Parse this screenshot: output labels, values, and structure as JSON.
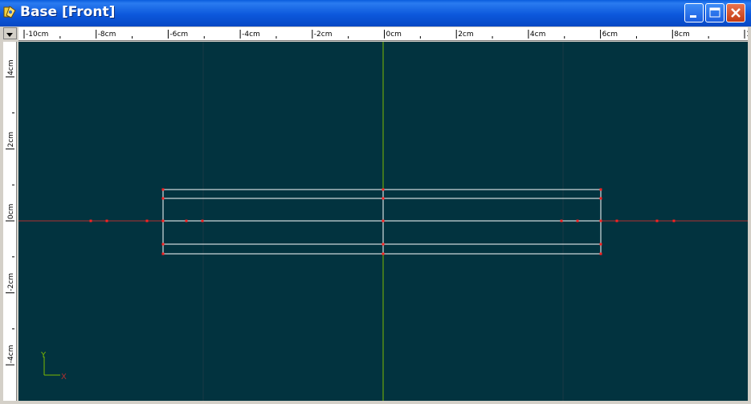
{
  "window": {
    "title": "Base [Front]",
    "buttons": {
      "minimize": "minimize",
      "maximize": "maximize",
      "close": "close"
    }
  },
  "ruler": {
    "unit": "cm",
    "horizontal_labels": [
      "-10cm",
      "-8cm",
      "-6cm",
      "-4cm",
      "-2cm",
      "0cm",
      "2cm",
      "4cm",
      "6cm",
      "8cm",
      "1"
    ],
    "vertical_labels": [
      "4cm",
      "2cm",
      "0cm",
      "-2cm",
      "-4cm"
    ]
  },
  "axes": {
    "x_label": "X",
    "y_label": "Y"
  },
  "colors": {
    "viewport_bg": "#02333f",
    "shape_outline": "#ffffff",
    "control_point": "#ff2020",
    "y_axis": "#7cb800",
    "x_axis": "#b03030",
    "grid_line": "#1a3a44"
  }
}
